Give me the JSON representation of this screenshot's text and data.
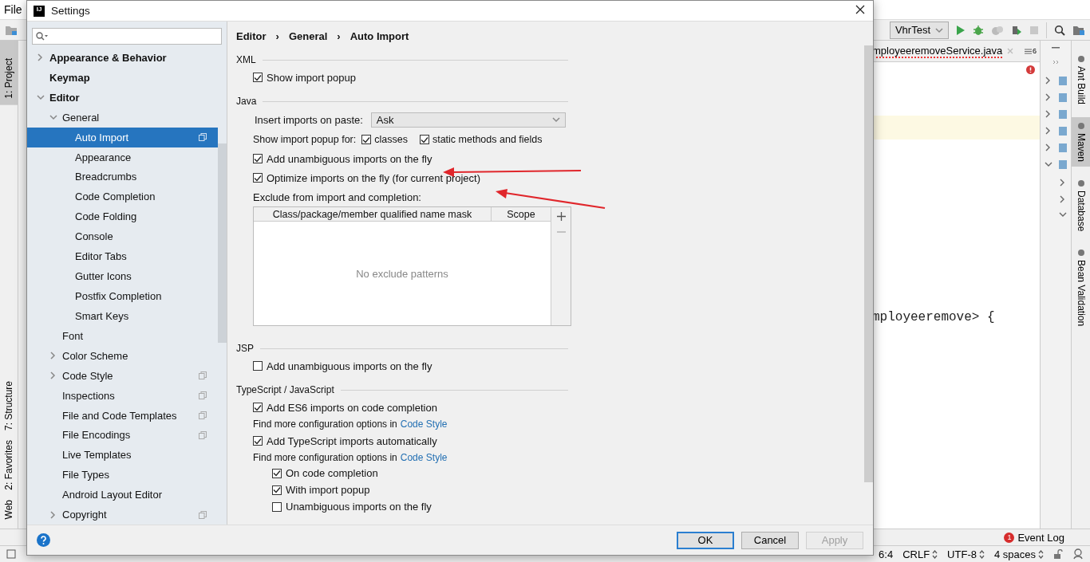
{
  "ide": {
    "menu": [
      {
        "label": "File"
      }
    ],
    "run_config": "VhrTest",
    "editor_tab": {
      "label": "mployeeremoveService.java",
      "has_error": true
    },
    "tab_count": "6",
    "code_line": "mployeeremove> {",
    "left_tool_windows_top": [
      {
        "label": "1: Project",
        "selected": true
      }
    ],
    "left_tool_windows_bottom": [
      {
        "label": "7: Structure",
        "selected": false
      },
      {
        "label": "2: Favorites",
        "selected": false
      },
      {
        "label": "Web",
        "selected": false
      }
    ],
    "right_tool_windows": [
      {
        "label": "Ant Build",
        "selected": false
      },
      {
        "label": "Maven",
        "selected": true
      },
      {
        "label": "Database",
        "selected": false
      },
      {
        "label": "Bean Validation",
        "selected": false
      }
    ],
    "event_log": {
      "label": "Event Log",
      "count": "1"
    },
    "status_bar": {
      "position": "6:4",
      "line_separator": "CRLF",
      "encoding": "UTF-8",
      "indent": "4 spaces"
    }
  },
  "dialog": {
    "app_logo": "IJ",
    "title": "Settings",
    "tree": [
      {
        "label": "Appearance & Behavior",
        "expanded": false,
        "selected": false
      },
      {
        "label": "Keymap",
        "selected": false
      },
      {
        "label": "Editor",
        "expanded": true,
        "selected": false,
        "children": [
          {
            "label": "General",
            "expanded": true,
            "selected": false,
            "children": [
              {
                "label": "Auto Import",
                "selected": true,
                "per_project": true
              },
              {
                "label": "Appearance",
                "selected": false
              },
              {
                "label": "Breadcrumbs",
                "selected": false
              },
              {
                "label": "Code Completion",
                "selected": false
              },
              {
                "label": "Code Folding",
                "selected": false
              },
              {
                "label": "Console",
                "selected": false
              },
              {
                "label": "Editor Tabs",
                "selected": false
              },
              {
                "label": "Gutter Icons",
                "selected": false
              },
              {
                "label": "Postfix Completion",
                "selected": false
              },
              {
                "label": "Smart Keys",
                "selected": false
              }
            ]
          },
          {
            "label": "Font",
            "selected": false
          },
          {
            "label": "Color Scheme",
            "expanded": false,
            "selected": false
          },
          {
            "label": "Code Style",
            "expanded": false,
            "selected": false,
            "per_project": true
          },
          {
            "label": "Inspections",
            "selected": false,
            "per_project": true
          },
          {
            "label": "File and Code Templates",
            "selected": false,
            "per_project": true
          },
          {
            "label": "File Encodings",
            "selected": false,
            "per_project": true
          },
          {
            "label": "Live Templates",
            "selected": false
          },
          {
            "label": "File Types",
            "selected": false
          },
          {
            "label": "Android Layout Editor",
            "selected": false
          },
          {
            "label": "Copyright",
            "expanded": false,
            "selected": false,
            "per_project": true
          }
        ]
      }
    ],
    "breadcrumb": [
      "Editor",
      "General",
      "Auto Import"
    ],
    "breadcrumb_separator": "›",
    "sections": [
      {
        "title": "XML",
        "items": [
          {
            "kind": "checkbox",
            "label": "Show import popup",
            "checked": true
          }
        ]
      },
      {
        "title": "Java",
        "items": [
          {
            "kind": "dropdown",
            "label": "Insert imports on paste:",
            "value": "Ask"
          },
          {
            "kind": "checkgroup",
            "label": "Show import popup for:",
            "options": [
              {
                "label": "classes",
                "checked": true
              },
              {
                "label": "static methods and fields",
                "checked": true
              }
            ]
          },
          {
            "kind": "checkbox",
            "label": "Add unambiguous imports on the fly",
            "checked": true
          },
          {
            "kind": "checkbox",
            "label": "Optimize imports on the fly (for current project)",
            "checked": true
          },
          {
            "kind": "table",
            "label": "Exclude from import and completion:",
            "columns": [
              "Class/package/member qualified name mask",
              "Scope"
            ],
            "empty_text": "No exclude patterns"
          }
        ]
      },
      {
        "title": "JSP",
        "items": [
          {
            "kind": "checkbox",
            "label": "Add unambiguous imports on the fly",
            "checked": false
          }
        ]
      },
      {
        "title": "TypeScript / JavaScript",
        "items": [
          {
            "kind": "checkbox",
            "label": "Add ES6 imports on code completion",
            "checked": true,
            "hint": "Find more configuration options in",
            "hint_link": "Code Style"
          },
          {
            "kind": "checkbox",
            "label": "Add TypeScript imports automatically",
            "checked": true,
            "hint": "Find more configuration options in",
            "hint_link": "Code Style",
            "children": [
              {
                "kind": "checkbox",
                "label": "On code completion",
                "checked": true
              },
              {
                "kind": "checkbox",
                "label": "With import popup",
                "checked": true
              },
              {
                "kind": "checkbox",
                "label": "Unambiguous imports on the fly",
                "checked": false
              }
            ]
          }
        ]
      }
    ],
    "buttons": [
      {
        "label": "OK",
        "default": true,
        "disabled": false
      },
      {
        "label": "Cancel",
        "default": false,
        "disabled": false
      },
      {
        "label": "Apply",
        "default": false,
        "disabled": true
      }
    ]
  }
}
